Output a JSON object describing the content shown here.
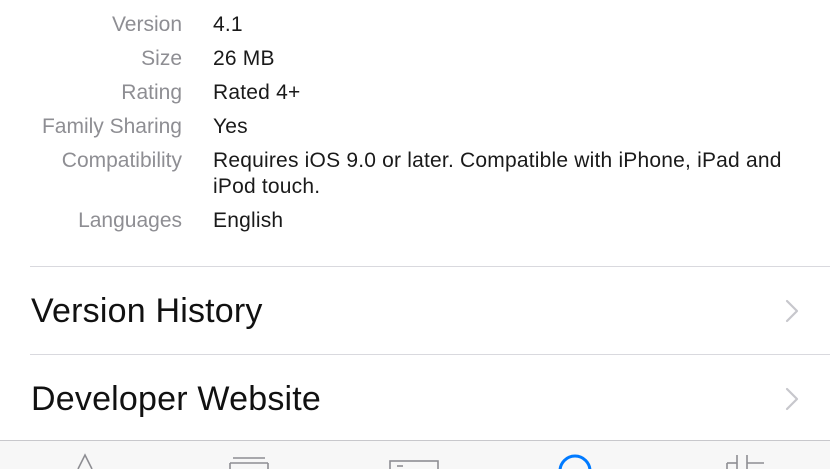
{
  "info": {
    "rows": [
      {
        "label": "Version",
        "value": "4.1"
      },
      {
        "label": "Size",
        "value": "26 MB"
      },
      {
        "label": "Rating",
        "value": "Rated 4+"
      },
      {
        "label": "Family Sharing",
        "value": "Yes"
      },
      {
        "label": "Compatibility",
        "value": "Requires iOS 9.0 or later. Compatible with iPhone, iPad and iPod touch."
      },
      {
        "label": "Languages",
        "value": "English"
      }
    ]
  },
  "links": {
    "version_history": "Version History",
    "developer_website": "Developer Website"
  },
  "tabbar": {
    "icons": [
      "featured-icon",
      "top-charts-icon",
      "explore-icon",
      "search-icon",
      "updates-icon"
    ],
    "accent_color": "#007aff"
  }
}
